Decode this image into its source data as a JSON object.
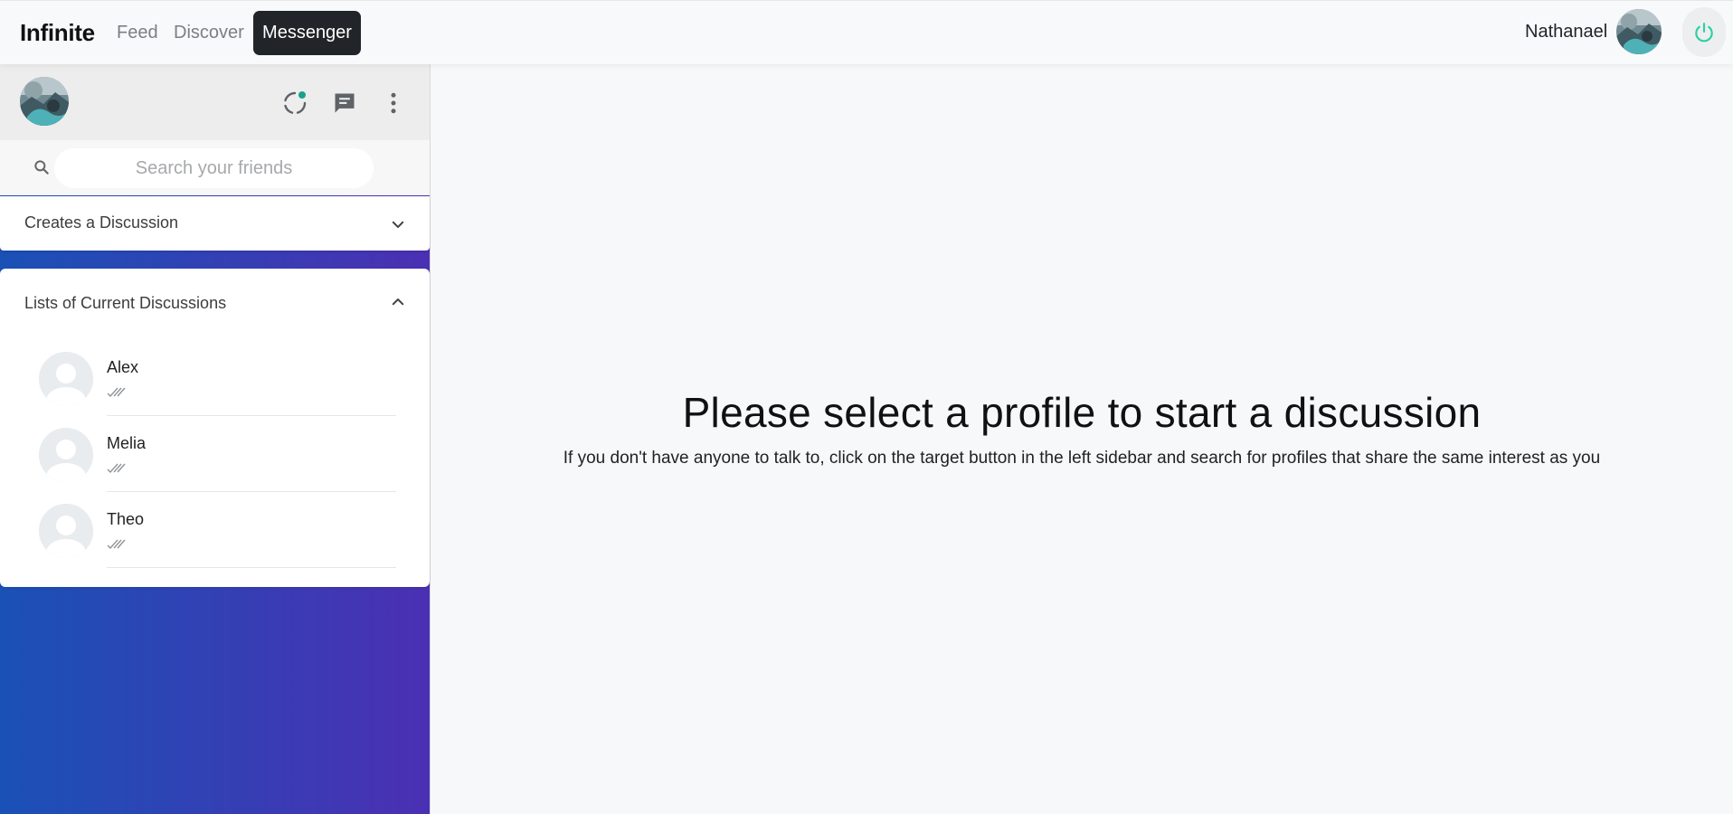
{
  "navbar": {
    "brand": "Infinite",
    "links": [
      "Feed",
      "Discover",
      "Messenger"
    ],
    "active_link": "Messenger",
    "username": "Nathanael",
    "avatar_icon": "user-photo",
    "power_icon": "power-icon",
    "accent_color": "#2fd0a0"
  },
  "sidebar": {
    "header": {
      "avatar_icon": "user-photo",
      "icons": [
        "status-icon",
        "new-chat-icon",
        "more-vert-icon"
      ],
      "status_dot_color": "#1aa18d"
    },
    "search": {
      "placeholder": "Search your friends",
      "value": ""
    },
    "create_panel": {
      "title": "Creates a Discussion",
      "expanded": false
    },
    "discussions_panel": {
      "title": "Lists of Current Discussions",
      "expanded": true,
      "items": [
        {
          "name": "Alex",
          "status_icon": "double-check-icon"
        },
        {
          "name": "Melia",
          "status_icon": "double-check-icon"
        },
        {
          "name": "Theo",
          "status_icon": "double-check-icon"
        }
      ]
    },
    "gradient_colors": [
      "#1a51b6",
      "#4b30b3"
    ]
  },
  "main": {
    "title": "Please select a profile to start a discussion",
    "subtitle": "If you don't have anyone to talk to, click on the target button in the left sidebar and search for profiles that share the same interest as you"
  }
}
